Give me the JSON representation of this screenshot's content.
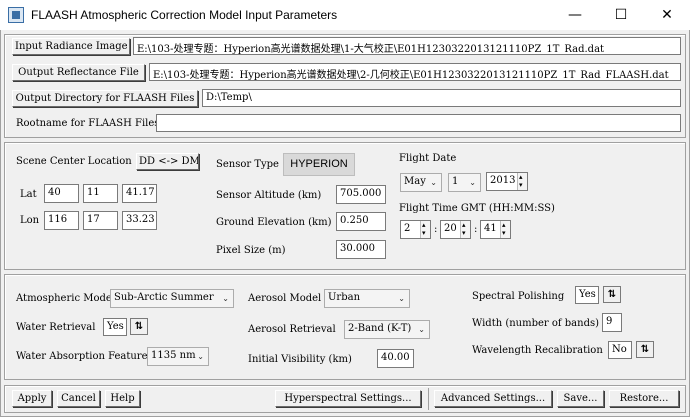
{
  "window": {
    "title": "FLAASH Atmospheric Correction Model Input Parameters",
    "minimize_glyph": "—",
    "maximize_glyph": "☐",
    "close_glyph": "✕"
  },
  "files": {
    "input_radiance_label": "Input Radiance Image",
    "input_radiance_value": "E:\\103-处理专题：Hyperion高光谱数据处理\\1-大气校正\\E01H1230322013121110PZ_1T_Rad.dat",
    "output_reflectance_label": "Output Reflectance File",
    "output_reflectance_value": "E:\\103-处理专题：Hyperion高光谱数据处理\\2-几何校正\\E01H1230322013121110PZ_1T_Rad_FLAASH.dat",
    "output_directory_label": "Output Directory for FLAASH Files",
    "output_directory_value": "D:\\Temp\\",
    "rootname_label": "Rootname for FLAASH Files",
    "rootname_value": ""
  },
  "scene": {
    "center_location_label": "Scene Center Location",
    "dd_dms_button": "DD <-> DMS",
    "lat_label": "Lat",
    "lat_deg": "40",
    "lat_min": "11",
    "lat_sec": "41.17",
    "lon_label": "Lon",
    "lon_deg": "116",
    "lon_min": "17",
    "lon_sec": "33.23"
  },
  "sensor": {
    "type_label": "Sensor Type",
    "type_value": "HYPERION",
    "altitude_label": "Sensor Altitude (km)",
    "altitude_value": "705.000",
    "elevation_label": "Ground Elevation (km)",
    "elevation_value": "0.250",
    "pixel_size_label": "Pixel Size (m)",
    "pixel_size_value": "30.000"
  },
  "flight": {
    "date_label": "Flight Date",
    "month": "May",
    "day": "1",
    "year": "2013",
    "time_label": "Flight Time GMT (HH:MM:SS)",
    "hour": "2",
    "minute": "20",
    "second": "41",
    "sep": ":"
  },
  "atmos": {
    "model_label": "Atmospheric Model",
    "model_value": "Sub-Arctic Summer",
    "water_retrieval_label": "Water Retrieval",
    "water_retrieval_value": "Yes",
    "water_absorption_label": "Water Absorption Feature",
    "water_absorption_value": "1135 nm",
    "aerosol_model_label": "Aerosol Model",
    "aerosol_model_value": "Urban",
    "aerosol_retrieval_label": "Aerosol Retrieval",
    "aerosol_retrieval_value": "2-Band (K-T)",
    "visibility_label": "Initial Visibility (km)",
    "visibility_value": "40.00",
    "spectral_polishing_label": "Spectral Polishing",
    "spectral_polishing_value": "Yes",
    "width_label": "Width (number of bands)",
    "width_value": "9",
    "wavelength_recal_label": "Wavelength Recalibration",
    "wavelength_recal_value": "No",
    "toggle_glyph": "⇅"
  },
  "footer": {
    "apply": "Apply",
    "cancel": "Cancel",
    "help": "Help",
    "hyperspectral": "Hyperspectral Settings...",
    "advanced": "Advanced Settings...",
    "save": "Save...",
    "restore": "Restore..."
  },
  "icons": {
    "dropdown": "⌄",
    "spin_up": "▴",
    "spin_down": "▾"
  }
}
